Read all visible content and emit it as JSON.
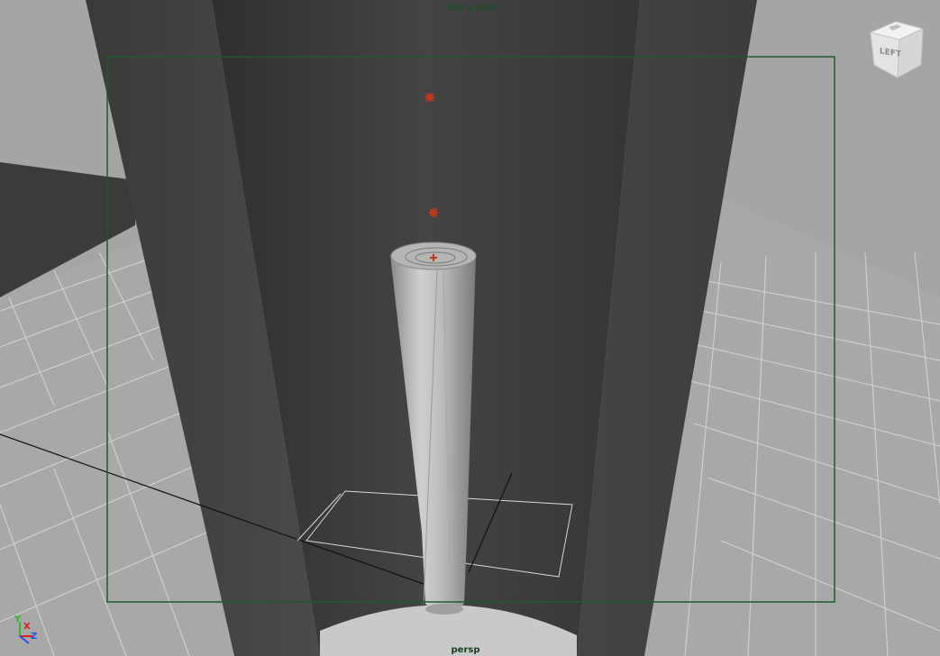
{
  "viewport": {
    "resolution_gate_label": "320 x 240",
    "camera_label": "persp"
  },
  "viewcube": {
    "face_label": "LEFT"
  },
  "axis_gizmo": {
    "y_label": "Y",
    "x_label": "X",
    "z_label": "Z"
  },
  "colors": {
    "background": "#a5a5a5",
    "grid_line": "#d9d9d9",
    "object_dark": "#3a3a3a",
    "resolution_gate": "#1e5a2e",
    "pivot_marker": "#c0391b"
  },
  "icons": [
    "viewcube-icon",
    "axis-gizmo-icon"
  ]
}
